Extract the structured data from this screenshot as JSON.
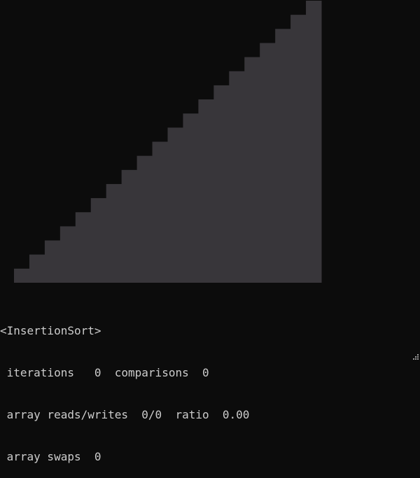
{
  "window": {
    "background_color": "#0c0c0c",
    "text_color": "#cccccc"
  },
  "visualization": {
    "bar_color": "#38363a",
    "bar_values": [
      1,
      2,
      3,
      4,
      5,
      6,
      7,
      8,
      9,
      10,
      11,
      12,
      13,
      14,
      15,
      16,
      17,
      18,
      19,
      20
    ],
    "max_value": 20
  },
  "stats": {
    "algorithm_header": "<InsertionSort>",
    "line_iterations": " iterations   0  comparisons  0",
    "line_reads_writes": " array reads/writes  0/0  ratio  0.00",
    "line_swaps": " array swaps  0"
  },
  "resize_grip_icon": "resize-grip-icon"
}
